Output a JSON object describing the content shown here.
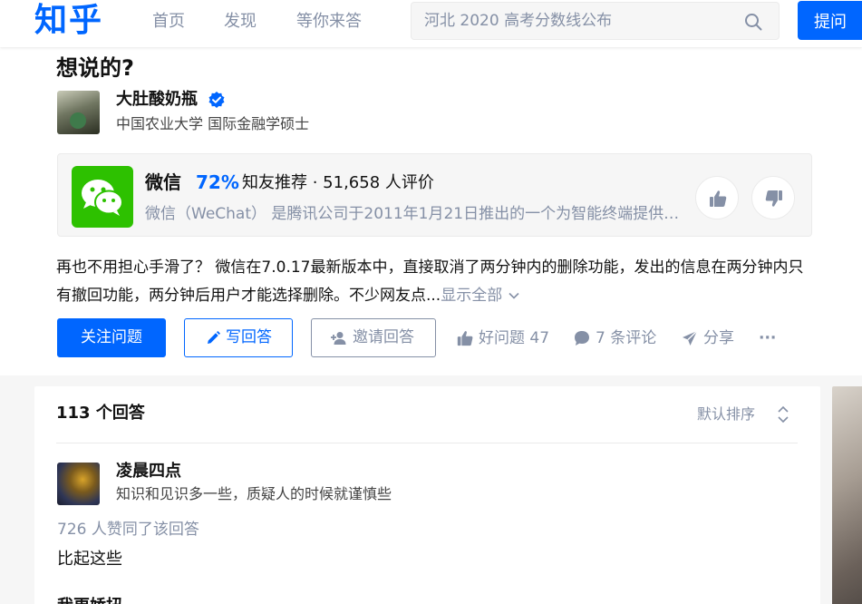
{
  "header": {
    "logo": "知乎",
    "nav": [
      "首页",
      "发现",
      "等你来答"
    ],
    "search_placeholder": "河北 2020 高考分数线公布",
    "ask_label": "提问"
  },
  "question": {
    "title_tail": "想说的?",
    "author": {
      "name": "大肚酸奶瓶",
      "bio": "中国农业大学 国际金融学硕士"
    },
    "topic": {
      "name": "微信",
      "percent": "72%",
      "recommend": "知友推荐 · 51,658 人评价",
      "description": "微信（WeChat） 是腾讯公司于2011年1月21日推出的一个为智能终端提供即时通讯服务的免费应用程序"
    },
    "excerpt": "再也不用担心手滑了？ 微信在7.0.17最新版本中，直接取消了两分钟内的删除功能，发出的信息在两分钟内只有撤回功能，两分钟后用户才能选择删除。不少网友点...",
    "show_all": "显示全部",
    "buttons": {
      "follow": "关注问题",
      "write": "写回答",
      "invite": "邀请回答"
    },
    "actions": {
      "good_question": "好问题 47",
      "comments": "7 条评论",
      "share": "分享",
      "more": "···"
    }
  },
  "answers": {
    "count_label": "113 个回答",
    "sort_label": "默认排序",
    "first": {
      "author_name": "凌晨四点",
      "author_bio": "知识和见识多一些，质疑人的时候就谨慎些",
      "upvotes": "726 人赞同了该回答",
      "text": "比起这些",
      "next_line": "我更娇扭"
    }
  },
  "colors": {
    "brand_blue": "#0066ff",
    "wechat_green": "#2dc100",
    "muted_gray": "#8590a6"
  }
}
